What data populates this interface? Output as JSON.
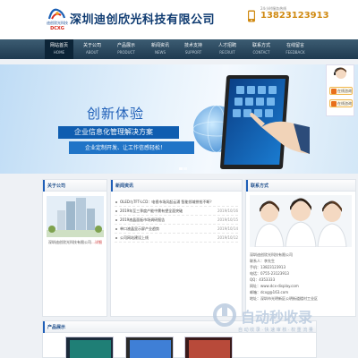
{
  "header": {
    "logo_name": "迪创欣光科技",
    "logo_abbr": "DCXG",
    "company_name": "深圳迪创欣光科技有限公司",
    "hotline_label": "24小时服务热线",
    "hotline_number": "13823123913"
  },
  "nav": {
    "items": [
      {
        "zh": "网站首页",
        "en": "HOME"
      },
      {
        "zh": "关于公司",
        "en": "ABOUT"
      },
      {
        "zh": "产品展示",
        "en": "PRODUCT"
      },
      {
        "zh": "新闻资讯",
        "en": "NEWS"
      },
      {
        "zh": "技术支持",
        "en": "SUPPORT"
      },
      {
        "zh": "人才招聘",
        "en": "RECRUIT"
      },
      {
        "zh": "联系方式",
        "en": "CONTACT"
      },
      {
        "zh": "在线留言",
        "en": "FEEDBACK"
      }
    ]
  },
  "banner": {
    "title": "创新体验",
    "line1": "企业信息化管理解决方案",
    "line2": "企业定制开发、让工作信感轻松！"
  },
  "float": {
    "qq1": "在线咨询",
    "qq2": "在线咨询"
  },
  "about": {
    "title": "关于公司",
    "text": "深圳迪创欣光科技有限公司",
    "more": "…详细"
  },
  "news": {
    "title": "新闻资讯",
    "items": [
      {
        "t": "OLED与TFT-LCD：电视市场风起云涌 智能领域拼抢不断？",
        "d": ""
      },
      {
        "t": "2019年至三季度产能中需有望全面突破",
        "d": "2019/10/16"
      },
      {
        "t": "2019液晶面板市场调研报告",
        "d": "2019/10/15"
      },
      {
        "t": "单口液晶显示屏产业趋势",
        "d": "2019/10/14"
      },
      {
        "t": "公司网站建设上线",
        "d": "2019/10/12"
      }
    ]
  },
  "contact": {
    "title": "联系方式",
    "lines": [
      "深圳迪创欣光科技有限公司",
      "联系人：李先生",
      "手机：13823123913",
      "电话：0755-23123913",
      "QQ：4353333",
      "网址：www.dcx-display.com",
      "邮箱：dcxg@163.com",
      "地址：深圳市光明新区公明街道楼村工业区"
    ]
  },
  "products": {
    "title": "产品展示"
  },
  "watermark": {
    "text": "自动秒收录",
    "sub": "自 动 收 录 · 快 速 审 核 · 权 重 流 量"
  }
}
